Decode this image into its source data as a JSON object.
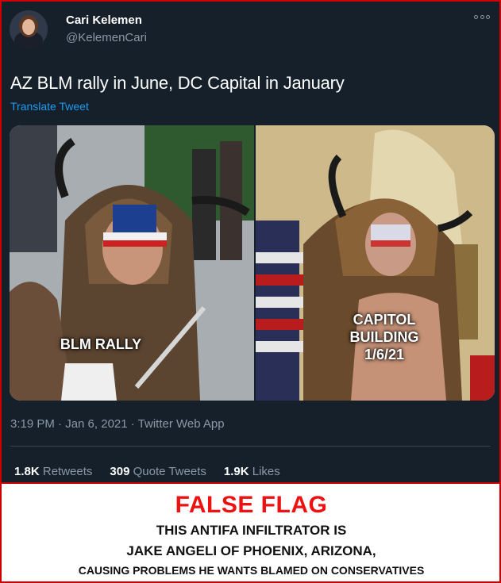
{
  "tweet": {
    "display_name": "Cari Kelemen",
    "handle": "@KelemenCari",
    "text": "AZ BLM rally in June, DC Capital in January",
    "translate": "Translate Tweet",
    "timestamp": "3:19 PM · Jan 6, 2021 · Twitter Web App",
    "stats": {
      "retweets_count": "1.8K",
      "retweets_label": "Retweets",
      "quotes_count": "309",
      "quotes_label": "Quote Tweets",
      "likes_count": "1.9K",
      "likes_label": "Likes"
    },
    "icons": {
      "more": "more-options-icon"
    },
    "colors": {
      "background": "#15202b",
      "link": "#1d9bf0",
      "muted": "#8b98a5"
    }
  },
  "media": {
    "left_caption": "BLM RALLY",
    "right_caption_lines": [
      "CAPITOL",
      "BUILDING",
      "1/6/21"
    ]
  },
  "banner": {
    "title": "FALSE FLAG",
    "line1": "THIS ANTIFA INFILTRATOR IS",
    "line2": "JAKE ANGELI OF PHOENIX, ARIZONA,",
    "line3": "CAUSING PROBLEMS HE WANTS BLAMED ON CONSERVATIVES",
    "colors": {
      "title": "#ee1111",
      "border": "#cc0000"
    }
  }
}
